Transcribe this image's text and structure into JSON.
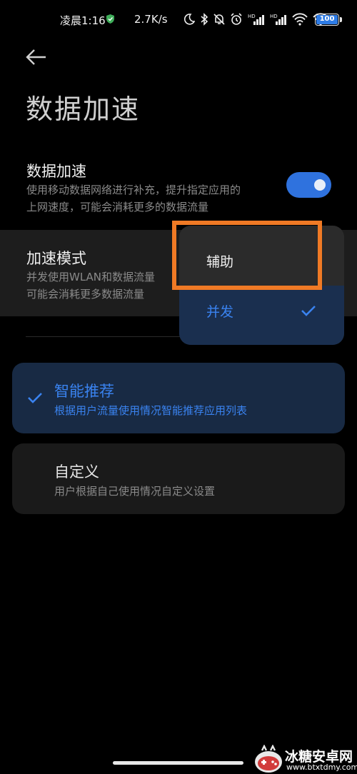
{
  "status_bar": {
    "time": "凌晨1:16",
    "speed": "2.7K/s",
    "battery": "100"
  },
  "header": {
    "title": "数据加速"
  },
  "data_accel": {
    "title": "数据加速",
    "desc_line1": "使用移动数据网络进行补充，提升指定应用的",
    "desc_line2": "上网速度，可能会消耗更多的数据流量",
    "enabled": true
  },
  "mode": {
    "title": "加速模式",
    "desc_line1": "并发使用WLAN和数据流量",
    "desc_line2": "可能会消耗更多数据流量"
  },
  "cards": {
    "smart": {
      "title": "智能推荐",
      "desc": "根据用户流量使用情况智能推荐应用列表",
      "selected": true
    },
    "custom": {
      "title": "自定义",
      "desc": "用户根据自己使用情况自定义设置"
    }
  },
  "dropdown": {
    "options": [
      "辅助",
      "并发"
    ],
    "selected": "并发"
  },
  "watermark": {
    "title": "冰糖安卓网",
    "url": "www.btxtdmy.com"
  },
  "colors": {
    "accent": "#2f72de",
    "highlight": "#f07a25"
  }
}
